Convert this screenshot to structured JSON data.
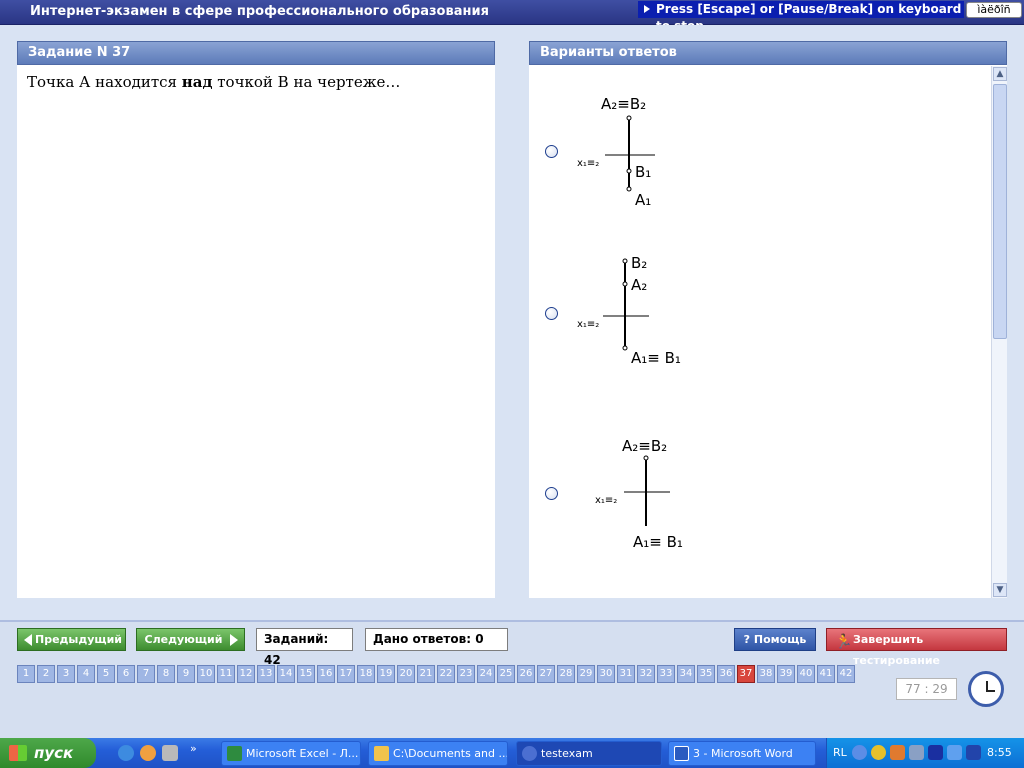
{
  "window": {
    "title": "Интернет-экзамен в сфере профессионального образования",
    "escape_hint": "Press [Escape] or [Pause/Break] on keyboard to stop",
    "lang_indicator": "ìàëðîñ"
  },
  "task_panel": {
    "header": "Задание N 37",
    "question_pre": "Точка А находится ",
    "question_bold": "над",
    "question_post": " точкой В на чертеже…"
  },
  "answers_panel": {
    "header": "Варианты ответов",
    "options": [
      {
        "labels": {
          "top": "A₂≡B₂",
          "axis": "x₁≡₂",
          "mid": "B₁",
          "bottom": "A₁"
        }
      },
      {
        "labels": {
          "top": "B₂",
          "mid": "A₂",
          "axis": "x₁≡₂",
          "bottom": "A₁≡ B₁"
        }
      },
      {
        "labels": {
          "top": "A₂≡B₂",
          "axis": "x₁≡₂",
          "bottom": "A₁≡ B₁"
        }
      }
    ]
  },
  "nav": {
    "prev_label": "Предыдущий",
    "next_label": "Следующий",
    "tasks_total": "Заданий: 42",
    "answers_given": "Дано ответов: 0",
    "help_label": "Помощь",
    "finish_label": "Завершить тестирование"
  },
  "pages": {
    "numbers": [
      "1",
      "2",
      "3",
      "4",
      "5",
      "6",
      "7",
      "8",
      "9",
      "10",
      "11",
      "12",
      "13",
      "14",
      "15",
      "16",
      "17",
      "18",
      "19",
      "20",
      "21",
      "22",
      "23",
      "24",
      "25",
      "26",
      "27",
      "28",
      "29",
      "30",
      "31",
      "32",
      "33",
      "34",
      "35",
      "36",
      "37",
      "38",
      "39",
      "40",
      "41",
      "42"
    ],
    "current": "37"
  },
  "timer": {
    "value": "77 : 29"
  },
  "taskbar": {
    "start_label": "пуск",
    "tasks": [
      "Microsoft Excel - Л...",
      "C:\\Documents and ...",
      "testexam",
      "3 - Microsoft Word"
    ],
    "active_task": "testexam",
    "lang": "RL",
    "time": "8:55"
  },
  "colors": {
    "accent": "#2a3584",
    "current_page": "#d8463d",
    "green_button": "#3d8c2f",
    "finish_button": "#c4373f"
  }
}
